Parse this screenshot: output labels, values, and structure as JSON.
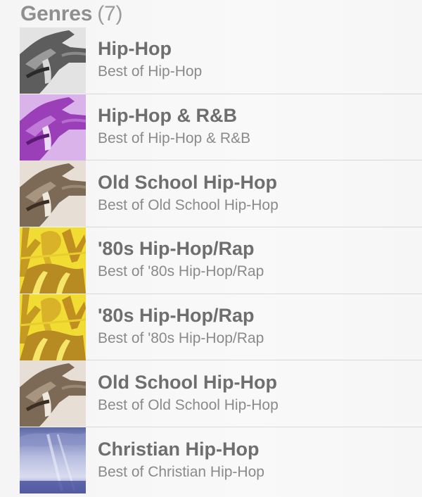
{
  "section": {
    "title": "Genres",
    "count": "(7)"
  },
  "genres": [
    {
      "title": "Hip-Hop",
      "subtitle": "Best of Hip-Hop",
      "artwork": "hands-artwork-gray"
    },
    {
      "title": "Hip-Hop & R&B",
      "subtitle": "Best of Hip-Hop & R&B",
      "artwork": "hands-artwork-purple"
    },
    {
      "title": "Old School Hip-Hop",
      "subtitle": "Best of Old School Hip-Hop",
      "artwork": "hands-artwork-sepia"
    },
    {
      "title": "'80s Hip-Hop/Rap",
      "subtitle": "Best of '80s Hip-Hop/Rap",
      "artwork": "graffiti-artwork-yellow"
    },
    {
      "title": "'80s Hip-Hop/Rap",
      "subtitle": "Best of '80s Hip-Hop/Rap",
      "artwork": "graffiti-artwork-yellow"
    },
    {
      "title": "Old School Hip-Hop",
      "subtitle": "Best of Old School Hip-Hop",
      "artwork": "hands-artwork-sepia"
    },
    {
      "title": "Christian Hip-Hop",
      "subtitle": "Best of Christian Hip-Hop",
      "artwork": "sky-artwork-blue"
    }
  ],
  "colors": {
    "gray_tint": "#8c8c8c",
    "purple_tint": "#a14fc0",
    "sepia_tint": "#8a7764",
    "yellow_bg": "#f2dc2a",
    "sky_top": "#6f78b0"
  }
}
